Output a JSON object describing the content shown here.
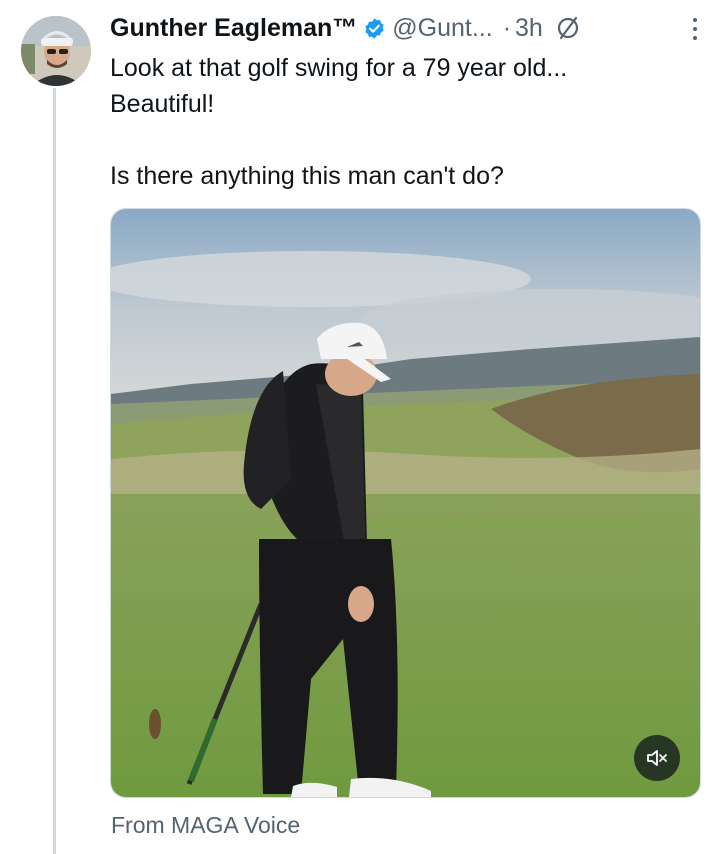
{
  "author": {
    "name": "Gunther Eagleman™",
    "handle": "@Gunt...",
    "separator": "·",
    "time": "3h",
    "verified": true
  },
  "tweet": {
    "line1": "Look at that golf swing for a 79 year old...",
    "line2": "Beautiful!",
    "line3": "Is there anything this man can't do?"
  },
  "media": {
    "type": "video",
    "muted": true
  },
  "source": "From MAGA Voice",
  "colors": {
    "text_primary": "#0f1419",
    "text_secondary": "#536471",
    "verified_blue": "#1d9bf0",
    "thread_line": "#cfd9de"
  },
  "icons": [
    "verified-badge-icon",
    "grok-icon",
    "more-options-icon",
    "muted-speaker-icon"
  ]
}
